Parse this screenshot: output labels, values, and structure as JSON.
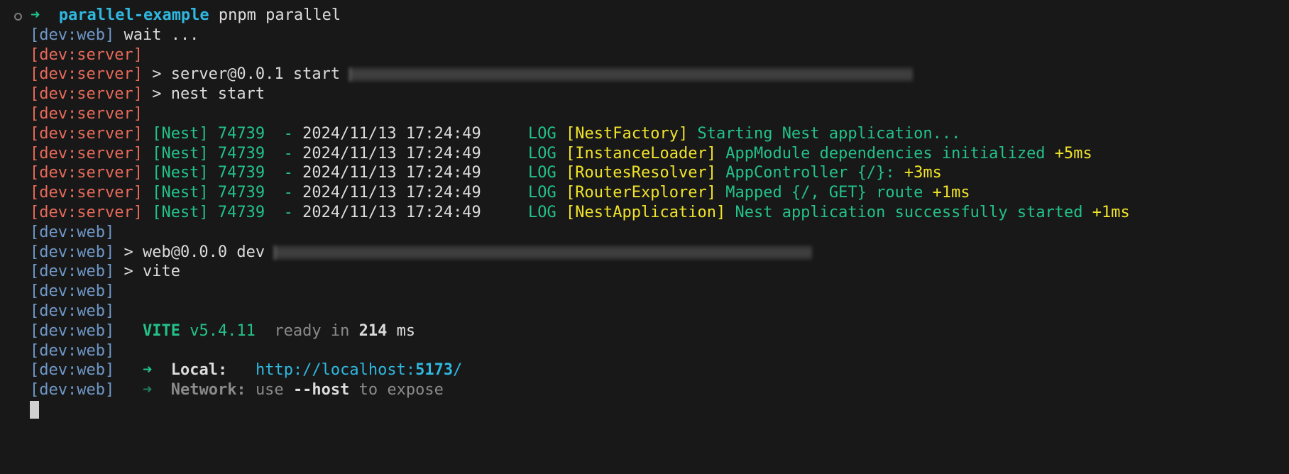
{
  "prompt": {
    "arrow": "➜",
    "directory": "parallel-example",
    "command": "pnpm parallel"
  },
  "lines": [
    {
      "prefix": "[dev:web]",
      "text": "wait ..."
    },
    {
      "prefix": "[dev:server]"
    },
    {
      "prefix": "[dev:server]",
      "text": "> server@0.0.1 start"
    },
    {
      "prefix": "[dev:server]",
      "text": "> nest start"
    },
    {
      "prefix": "[dev:server]"
    },
    {
      "prefix": "[dev:server]",
      "nest": "[Nest] 74739  -",
      "time": "2024/11/13 17:24:49",
      "level": "LOG",
      "ctx": "[NestFactory]",
      "msg": "Starting Nest application...",
      "delta": ""
    },
    {
      "prefix": "[dev:server]",
      "nest": "[Nest] 74739  -",
      "time": "2024/11/13 17:24:49",
      "level": "LOG",
      "ctx": "[InstanceLoader]",
      "msg": "AppModule dependencies initialized",
      "delta": "+5ms"
    },
    {
      "prefix": "[dev:server]",
      "nest": "[Nest] 74739  -",
      "time": "2024/11/13 17:24:49",
      "level": "LOG",
      "ctx": "[RoutesResolver]",
      "msg": "AppController {/}:",
      "delta": "+3ms"
    },
    {
      "prefix": "[dev:server]",
      "nest": "[Nest] 74739  -",
      "time": "2024/11/13 17:24:49",
      "level": "LOG",
      "ctx": "[RouterExplorer]",
      "msg": "Mapped {/, GET} route",
      "delta": "+1ms"
    },
    {
      "prefix": "[dev:server]",
      "nest": "[Nest] 74739  -",
      "time": "2024/11/13 17:24:49",
      "level": "LOG",
      "ctx": "[NestApplication]",
      "msg": "Nest application successfully started",
      "delta": "+1ms"
    },
    {
      "prefix": "[dev:web]"
    },
    {
      "prefix": "[dev:web]",
      "text": "> web@0.0.0 dev"
    },
    {
      "prefix": "[dev:web]",
      "text": "> vite"
    },
    {
      "prefix": "[dev:web]"
    },
    {
      "prefix": "[dev:web]"
    },
    {
      "prefix": "[dev:web]",
      "vite_name": "VITE",
      "vite_version": "v5.4.11",
      "ready_in": "ready in",
      "ready_ms": "214",
      "ready_unit": "ms"
    },
    {
      "prefix": "[dev:web]"
    },
    {
      "prefix": "[dev:web]",
      "arrow": "➜",
      "label": "Local:",
      "url_base": "http://localhost:",
      "url_port": "5173",
      "url_tail": "/"
    },
    {
      "prefix": "[dev:web]",
      "arrow": "➜",
      "label": "Network:",
      "use": "use",
      "flag": "--host",
      "rest": "to expose"
    }
  ]
}
